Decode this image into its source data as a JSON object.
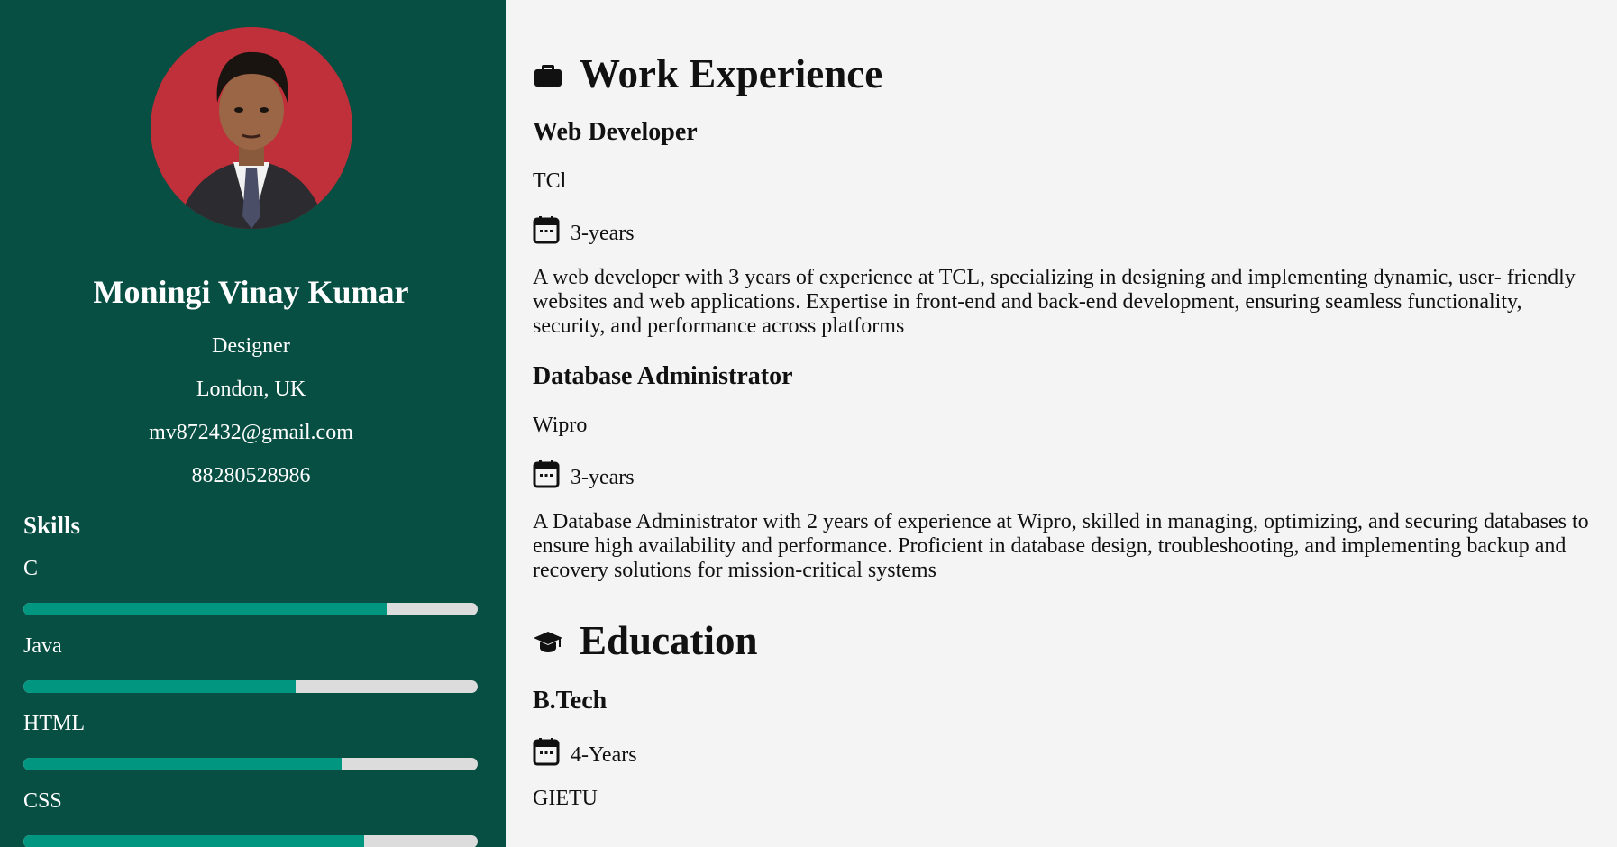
{
  "profile": {
    "name": "Moningi Vinay Kumar",
    "role": "Designer",
    "location": "London, UK",
    "email": "mv872432@gmail.com",
    "phone": "88280528986"
  },
  "skills": {
    "heading": "Skills",
    "items": [
      {
        "name": "C",
        "level": 0.8
      },
      {
        "name": "Java",
        "level": 0.6
      },
      {
        "name": "HTML",
        "level": 0.7
      },
      {
        "name": "CSS",
        "level": 0.75
      }
    ]
  },
  "work": {
    "heading": "Work Experience",
    "icon": "briefcase-icon",
    "jobs": [
      {
        "title": "Web Developer",
        "company": "TCl",
        "duration": "3-years",
        "description": "A web developer with 3 years of experience at TCL, specializing in designing and implementing dynamic, user- friendly websites and web applications. Expertise in front-end and back-end development, ensuring seamless functionality, security, and performance across platforms"
      },
      {
        "title": "Database Administrator",
        "company": "Wipro",
        "duration": "3-years",
        "description": "A Database Administrator with 2 years of experience at Wipro, skilled in managing, optimizing, and securing databases to ensure high availability and performance. Proficient in database design, troubleshooting, and implementing backup and recovery solutions for mission-critical systems"
      }
    ]
  },
  "education": {
    "heading": "Education",
    "icon": "graduation-cap-icon",
    "items": [
      {
        "title": "B.Tech",
        "duration": "4-Years",
        "institution": "GIETU"
      }
    ]
  },
  "colors": {
    "sidebar_bg": "#074e43",
    "skill_fill": "#009680",
    "skill_track": "#dcdcdc",
    "main_bg": "#f4f4f4"
  }
}
